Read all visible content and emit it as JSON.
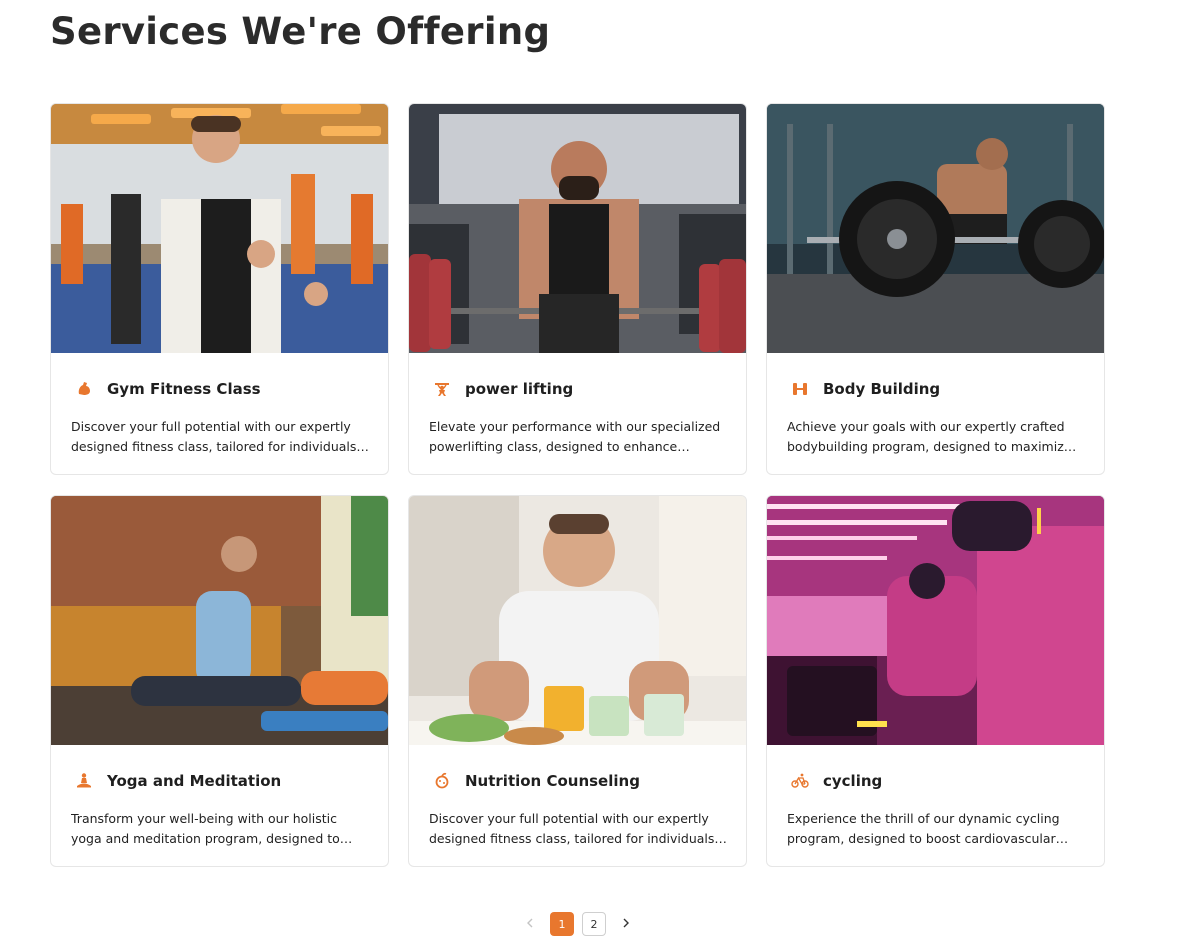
{
  "page": {
    "title": "Services We're Offering",
    "accent_color": "#e8772e"
  },
  "services": [
    {
      "title": "Gym Fitness Class",
      "icon": "flexed-arm-icon",
      "image": "teen boys doing martial arts fitness class in a bright gym",
      "description_lines": [
        "Discover your full potential with our expertly",
        "designed fitness class, tailored for individuals…"
      ]
    },
    {
      "title": "power lifting",
      "icon": "weightlifter-icon",
      "image": "muscular bearded man lifting a heavy barbell with red plates",
      "description_lines": [
        "Elevate your performance with our specialized",
        "powerlifting class, designed to enhance…"
      ]
    },
    {
      "title": "Body Building",
      "icon": "dumbbell-icon",
      "image": "bodybuilder lifting a large black barbell in a dark gym",
      "description_lines": [
        "Achieve your goals with our expertly crafted",
        "bodybuilding program, designed to maximiz…"
      ]
    },
    {
      "title": "Yoga and Meditation",
      "icon": "meditation-icon",
      "image": "man stretching in a yoga pose on a mat in a sunny loft",
      "description_lines": [
        "Transform your well-being with our holistic",
        "yoga and meditation program, designed to…"
      ]
    },
    {
      "title": "Nutrition Counseling",
      "icon": "nutrition-icon",
      "image": "smiling man at a table with healthy food and drinks",
      "description_lines": [
        "Discover your full potential with our expertly",
        "designed fitness class, tailored for individuals…"
      ]
    },
    {
      "title": "cycling",
      "icon": "bicycle-icon",
      "image": "women on stationary bikes with VR headsets under pink neon lights",
      "description_lines": [
        "Experience the thrill of our dynamic cycling",
        "program, designed to boost cardiovascular…"
      ]
    }
  ],
  "pagination": {
    "pages": [
      "1",
      "2"
    ],
    "current": "1",
    "prev_icon": "chevron-left-icon",
    "next_icon": "chevron-right-icon"
  }
}
